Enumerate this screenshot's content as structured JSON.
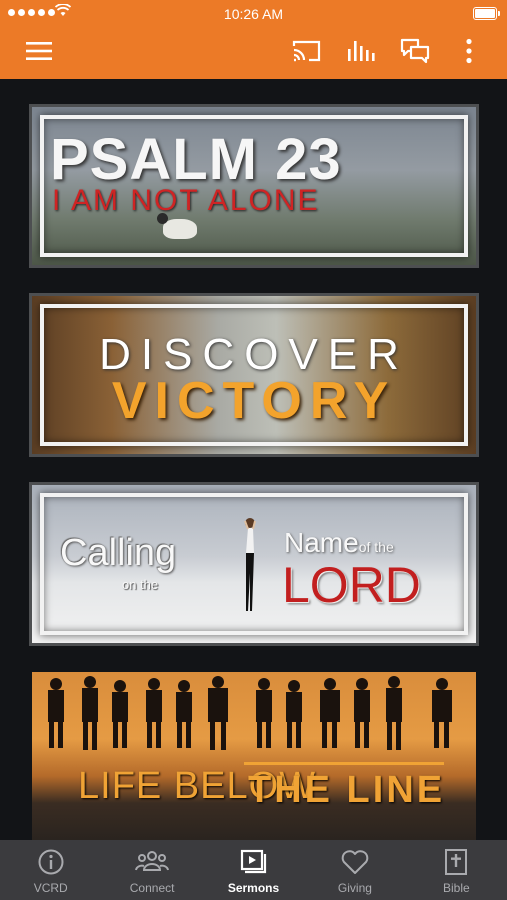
{
  "status_bar": {
    "time": "10:26 AM"
  },
  "header": {
    "icons": [
      "hamburger-menu-icon",
      "cast-icon",
      "audio-bars-icon",
      "chat-bubbles-icon",
      "more-vertical-icon"
    ],
    "background": "#ec7a27"
  },
  "sermons": [
    {
      "line1": "PSALM 23",
      "line2": "I AM NOT ALONE"
    },
    {
      "line1": "DISCOVER",
      "line2": "VICTORY"
    },
    {
      "line1": "Calling",
      "line2": "on the",
      "line3": "Name",
      "line3_small": "of the",
      "line4": "LORD"
    },
    {
      "line1": "LIFE BELOW",
      "line2": "THE LINE"
    }
  ],
  "tabs": [
    {
      "label": "VCRD",
      "icon": "info-circle-icon",
      "active": false
    },
    {
      "label": "Connect",
      "icon": "people-group-icon",
      "active": false
    },
    {
      "label": "Sermons",
      "icon": "video-play-icon",
      "active": true
    },
    {
      "label": "Giving",
      "icon": "heart-icon",
      "active": false
    },
    {
      "label": "Bible",
      "icon": "book-cross-icon",
      "active": false
    }
  ],
  "colors": {
    "accent": "#ec7a27",
    "tabbar": "#3b3b3e",
    "background": "#121417"
  }
}
